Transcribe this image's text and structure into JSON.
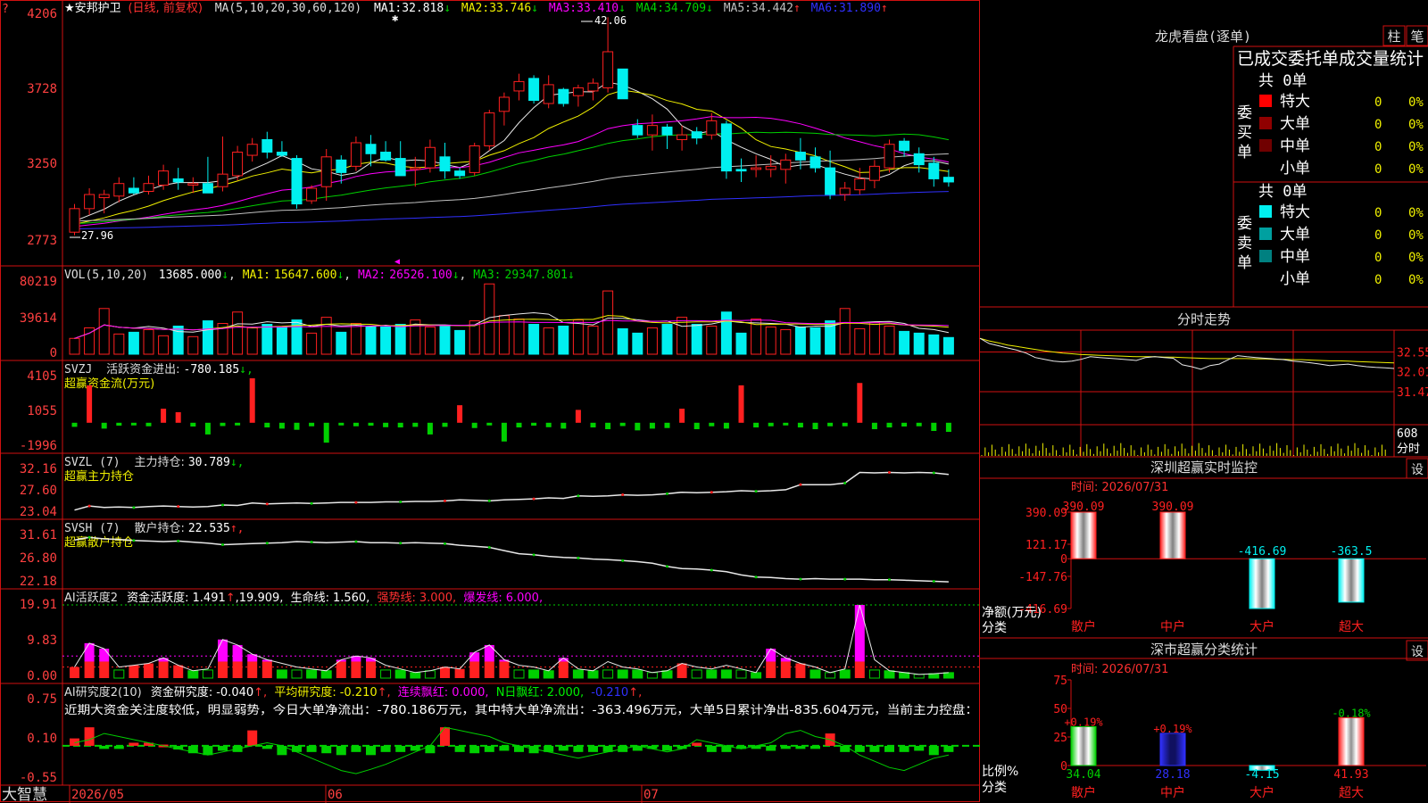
{
  "colors": {
    "up": "#ff2020",
    "down": "#00f0f0",
    "green": "#00d000",
    "frame": "#d01010",
    "axis": "#ff4040",
    "white": "#e8e8e8",
    "yellow": "#f0f000",
    "magenta": "#ff00ff",
    "blue": "#3030ff",
    "gray": "#c0c0c0",
    "text": "#dddddd"
  },
  "header": {
    "title": "★安邦护卫",
    "mode": "(日线, 前复权)",
    "ma_def": "MA(5,10,20,30,60,120)",
    "ma": [
      {
        "label": "MA1:",
        "value": "32.818",
        "arrow": "↓"
      },
      {
        "label": "MA2:",
        "value": "33.746",
        "arrow": "↓"
      },
      {
        "label": "MA3:",
        "value": "33.410",
        "arrow": "↓"
      },
      {
        "label": "MA4:",
        "value": "34.709",
        "arrow": "↓"
      },
      {
        "label": "MA5:",
        "value": "34.442",
        "arrow": "↑"
      },
      {
        "label": "MA6:",
        "value": "31.890",
        "arrow": "↑"
      }
    ],
    "high_label": "42.06",
    "low_label": "27.96",
    "corner": "?"
  },
  "vol_header": {
    "def": "VOL(5,10,20)",
    "value": "13685.000",
    "arrow": "↓",
    "ma": [
      {
        "label": "MA1:",
        "value": "15647.600",
        "arrow": "↓"
      },
      {
        "label": "MA2:",
        "value": "26526.100",
        "arrow": "↓"
      },
      {
        "label": "MA3:",
        "value": "29347.801",
        "arrow": "↓"
      }
    ]
  },
  "svzj_header": {
    "def": "SVZJ",
    "name": "活跃资金进出:",
    "value": "-780.185",
    "arrow": "↓,",
    "sub": "超赢资金流(万元)"
  },
  "svzl_header": {
    "def": "SVZL (7)",
    "name": "主力持仓:",
    "value": "30.789",
    "arrow": "↓,",
    "sub": "超赢主力持仓"
  },
  "svsh_header": {
    "def": "SVSH (7)",
    "name": "散户持仓:",
    "value": "22.535",
    "arrow": "↑,",
    "sub": "超赢散户持仓"
  },
  "ai_header": {
    "def": "AI活跃度2",
    "name": "资金活跃度:",
    "value": "1.491",
    "arrow": "↑",
    "v2": ",19.909,",
    "l3": "生命线:",
    "v3": "1.560,",
    "l4": "强势线:",
    "v4": "3.000,",
    "l5": "爆发线:",
    "v5": "6.000,"
  },
  "yj_header": {
    "def": "AI研究度2(10)",
    "name": "资金研究度:",
    "value": "-0.040",
    "arrow": "↑,",
    "l2": "平均研究度:",
    "v2": "-0.210",
    "a2": "↑,",
    "l3": "连续飘红:",
    "v3": "0.000,",
    "l4": "N日飘红:",
    "v4": "2.000,",
    "v5": "-0.210",
    "a5": "↑,",
    "comment": "近期大资金关注度较低，明显弱势，今日大单净流出：-780.186万元，其中特大单净流出：-363.496万元，大单5日累计净出-835.604万元，当前主力控盘："
  },
  "axes": {
    "price": [
      "4206",
      "3728",
      "3250",
      "2773"
    ],
    "vol": [
      "80219",
      "39614",
      "0"
    ],
    "svzj": [
      "4105",
      "1055",
      "-1996"
    ],
    "svzl": [
      "32.16",
      "27.60",
      "23.04"
    ],
    "svsh": [
      "31.61",
      "26.80",
      "22.18"
    ],
    "ai": [
      "19.91",
      "9.83",
      "0.00"
    ],
    "yj": [
      "0.75",
      "0.10",
      "-0.55"
    ]
  },
  "xaxis": {
    "logo": "大智慧",
    "ticks": [
      "2026/05",
      "06",
      "07"
    ]
  },
  "chart_data": {
    "type": "candlestick",
    "x_count": 60,
    "candles_ohlc": [
      [
        28.4,
        30.2,
        28.2,
        29.9
      ],
      [
        29.9,
        31.2,
        29.5,
        30.8
      ],
      [
        30.6,
        31.1,
        29.6,
        30.8
      ],
      [
        30.7,
        31.9,
        30.3,
        31.5
      ],
      [
        31.2,
        31.9,
        30.8,
        30.9
      ],
      [
        31.0,
        32.0,
        30.8,
        31.5
      ],
      [
        31.4,
        32.7,
        31.1,
        32.3
      ],
      [
        31.8,
        32.5,
        31.1,
        31.6
      ],
      [
        31.4,
        31.9,
        30.9,
        31.5
      ],
      [
        31.5,
        33.2,
        31.3,
        30.9
      ],
      [
        31.3,
        34.5,
        31.0,
        32.1
      ],
      [
        32.0,
        33.9,
        31.7,
        33.5
      ],
      [
        33.3,
        34.4,
        32.9,
        34.0
      ],
      [
        34.3,
        34.8,
        33.1,
        33.5
      ],
      [
        33.5,
        34.2,
        33.2,
        33.3
      ],
      [
        33.1,
        33.3,
        29.9,
        30.2
      ],
      [
        30.4,
        31.4,
        30.2,
        31.2
      ],
      [
        31.3,
        33.7,
        30.4,
        33.2
      ],
      [
        33.0,
        33.3,
        31.5,
        32.2
      ],
      [
        32.6,
        34.5,
        32.3,
        34.1
      ],
      [
        34.0,
        34.6,
        32.6,
        33.4
      ],
      [
        33.5,
        34.2,
        32.9,
        33.0
      ],
      [
        33.1,
        34.2,
        32.9,
        32.0
      ],
      [
        32.4,
        33.2,
        31.3,
        32.5
      ],
      [
        32.5,
        34.3,
        32.2,
        33.8
      ],
      [
        33.2,
        34.1,
        31.8,
        32.3
      ],
      [
        32.3,
        32.5,
        31.8,
        32.0
      ],
      [
        32.2,
        34.1,
        32.0,
        33.9
      ],
      [
        33.9,
        36.2,
        33.6,
        36.0
      ],
      [
        36.1,
        37.3,
        35.2,
        37.0
      ],
      [
        37.4,
        38.5,
        36.8,
        38.0
      ],
      [
        38.2,
        38.4,
        36.6,
        36.8
      ],
      [
        36.6,
        38.4,
        36.3,
        37.8
      ],
      [
        37.5,
        37.6,
        36.4,
        36.6
      ],
      [
        37.1,
        37.8,
        36.4,
        37.6
      ],
      [
        37.4,
        38.2,
        36.8,
        37.9
      ],
      [
        37.6,
        42.1,
        37.3,
        39.9
      ],
      [
        38.8,
        38.8,
        36.9,
        36.9
      ],
      [
        35.2,
        35.6,
        34.4,
        34.6
      ],
      [
        34.6,
        35.9,
        33.6,
        35.2
      ],
      [
        35.1,
        35.3,
        33.7,
        34.6
      ],
      [
        34.3,
        35.2,
        33.6,
        34.6
      ],
      [
        34.8,
        35.1,
        34.0,
        34.4
      ],
      [
        34.6,
        36.0,
        34.3,
        35.5
      ],
      [
        35.3,
        35.5,
        31.8,
        32.3
      ],
      [
        32.4,
        33.1,
        31.6,
        32.3
      ],
      [
        32.4,
        33.3,
        31.9,
        32.5
      ],
      [
        32.4,
        33.3,
        31.9,
        32.6
      ],
      [
        32.4,
        33.4,
        31.5,
        33.0
      ],
      [
        33.5,
        34.4,
        32.4,
        33.0
      ],
      [
        33.2,
        33.8,
        32.2,
        32.5
      ],
      [
        32.5,
        33.6,
        30.5,
        30.8
      ],
      [
        30.8,
        31.6,
        30.4,
        31.2
      ],
      [
        31.1,
        32.5,
        30.8,
        31.8
      ],
      [
        31.7,
        33.0,
        31.2,
        32.6
      ],
      [
        32.5,
        34.3,
        32.2,
        34.0
      ],
      [
        34.2,
        34.4,
        33.2,
        33.6
      ],
      [
        33.4,
        33.8,
        32.2,
        32.7
      ],
      [
        32.8,
        33.2,
        31.3,
        31.8
      ],
      [
        31.9,
        32.4,
        31.3,
        31.6
      ]
    ],
    "volume": [
      18000,
      30000,
      52000,
      23000,
      25000,
      28000,
      21000,
      32000,
      20000,
      38000,
      35000,
      48000,
      30000,
      34000,
      31000,
      39000,
      24000,
      42000,
      25000,
      35000,
      32000,
      31000,
      34000,
      39000,
      31000,
      32000,
      27000,
      38000,
      80000,
      44000,
      40000,
      34000,
      30000,
      32000,
      39000,
      32000,
      72000,
      29000,
      24000,
      30000,
      34000,
      42000,
      34000,
      32000,
      48000,
      24000,
      40000,
      31000,
      28000,
      31000,
      30000,
      38000,
      52000,
      29000,
      36000,
      32000,
      26000,
      24000,
      22000,
      19000
    ],
    "svzj": [
      -350,
      3200,
      -500,
      -250,
      -220,
      -300,
      1200,
      900,
      -320,
      -1000,
      -280,
      -150,
      3800,
      -400,
      -500,
      -600,
      -300,
      -1700,
      -200,
      -300,
      -250,
      -380,
      -400,
      -350,
      -1000,
      -350,
      1500,
      -450,
      -200,
      -1600,
      -400,
      -250,
      -380,
      -500,
      1100,
      -400,
      -550,
      -280,
      -650,
      -500,
      -450,
      1200,
      -550,
      -300,
      -500,
      3200,
      -400,
      -300,
      -200,
      -400,
      -550,
      -300,
      -300,
      3400,
      -550,
      -400,
      -320,
      -300,
      -700,
      -780
    ],
    "svzl": [
      23.8,
      24.6,
      24.3,
      24.4,
      24.3,
      24.5,
      24.6,
      24.5,
      24.4,
      24.5,
      24.8,
      24.7,
      25.2,
      25.0,
      25.1,
      25.2,
      25.1,
      25.2,
      25.3,
      25.3,
      25.3,
      25.4,
      25.4,
      25.5,
      25.5,
      25.6,
      25.8,
      25.7,
      25.6,
      25.8,
      25.9,
      26.0,
      26.2,
      26.1,
      26.6,
      26.5,
      26.6,
      26.8,
      26.7,
      26.8,
      27.0,
      27.3,
      27.2,
      27.3,
      27.4,
      27.6,
      27.5,
      27.6,
      27.8,
      28.8,
      28.8,
      28.8,
      29.1,
      31.2,
      31.1,
      31.2,
      31.1,
      31.2,
      31.1,
      30.8
    ],
    "svsh": [
      30.4,
      30.9,
      30.6,
      30.5,
      30.3,
      30.2,
      30.1,
      30.2,
      30.0,
      29.8,
      29.5,
      29.6,
      29.7,
      29.8,
      29.9,
      30.1,
      30.0,
      29.9,
      30.0,
      30.1,
      29.9,
      29.9,
      29.8,
      29.9,
      29.8,
      29.7,
      29.4,
      29.2,
      29.0,
      28.4,
      27.8,
      27.6,
      27.3,
      27.1,
      27.0,
      26.8,
      26.7,
      26.5,
      26.3,
      26.0,
      25.4,
      25.0,
      24.9,
      24.7,
      24.4,
      23.8,
      23.4,
      23.3,
      23.1,
      23.0,
      23.1,
      23.0,
      23.0,
      23.0,
      22.9,
      22.9,
      22.8,
      22.7,
      22.6,
      22.5
    ],
    "ai_activity": [
      3.0,
      9.5,
      8.0,
      3.0,
      3.5,
      4.0,
      5.5,
      3.5,
      2.0,
      2.5,
      10.5,
      9.0,
      6.5,
      5.0,
      4.0,
      3.0,
      2.5,
      2.0,
      5.0,
      6.0,
      5.5,
      3.5,
      2.5,
      1.5,
      2.0,
      3.0,
      2.5,
      7.0,
      9.0,
      5.0,
      3.5,
      3.0,
      2.0,
      5.5,
      2.5,
      2.0,
      4.5,
      3.0,
      2.5,
      1.5,
      2.0,
      4.0,
      3.0,
      2.5,
      3.5,
      2.5,
      1.5,
      8.0,
      5.5,
      4.0,
      3.0,
      1.5,
      2.5,
      19.91,
      5.0,
      2.0,
      1.5,
      1.0,
      1.2,
      1.49
    ],
    "ai_red": [
      true,
      true,
      true,
      false,
      true,
      true,
      true,
      true,
      false,
      false,
      true,
      true,
      true,
      true,
      false,
      false,
      false,
      false,
      true,
      true,
      true,
      false,
      false,
      false,
      false,
      true,
      true,
      true,
      true,
      true,
      false,
      false,
      false,
      true,
      false,
      false,
      false,
      false,
      false,
      false,
      false,
      true,
      false,
      false,
      false,
      false,
      false,
      true,
      true,
      true,
      false,
      false,
      false,
      true,
      false,
      false,
      false,
      false,
      false,
      false
    ],
    "ai_lines": {
      "strong": 3.0,
      "burst": 6.0,
      "max": 19.91
    },
    "yj_bars": [
      0.12,
      0.3,
      -0.05,
      -0.05,
      0.05,
      0.05,
      0.02,
      -0.06,
      -0.12,
      -0.15,
      -0.08,
      -0.1,
      0.25,
      -0.05,
      -0.15,
      -0.1,
      -0.1,
      -0.12,
      -0.15,
      -0.1,
      -0.15,
      -0.1,
      -0.1,
      -0.08,
      -0.12,
      0.3,
      -0.1,
      -0.12,
      -0.1,
      -0.08,
      -0.1,
      -0.12,
      -0.1,
      -0.08,
      -0.1,
      -0.1,
      -0.1,
      -0.1,
      -0.08,
      -0.05,
      -0.08,
      -0.05,
      0.05,
      -0.1,
      -0.1,
      -0.05,
      -0.05,
      -0.08,
      -0.05,
      -0.05,
      -0.05,
      0.2,
      -0.1,
      -0.1,
      -0.1,
      -0.1,
      -0.1,
      -0.08,
      -0.15,
      -0.1
    ]
  },
  "longhu": {
    "title": "龙虎看盘(逐单)",
    "btn1": "柱",
    "btn2": "笔",
    "tabs": "已成交委托单成交量统计",
    "buy": {
      "side": "委买单",
      "total": "共 0单",
      "rows": [
        {
          "name": "特大",
          "v": "0",
          "p": "0%",
          "color": "#ff0000"
        },
        {
          "name": "大单",
          "v": "0",
          "p": "0%",
          "color": "#900000"
        },
        {
          "name": "中单",
          "v": "0",
          "p": "0%",
          "color": "#700000"
        },
        {
          "name": "小单",
          "v": "0",
          "p": "0%",
          "color": ""
        }
      ]
    },
    "sell": {
      "side": "委卖单",
      "total": "共 0单",
      "rows": [
        {
          "name": "特大",
          "v": "0",
          "p": "0%",
          "color": "#00f0f0"
        },
        {
          "name": "大单",
          "v": "0",
          "p": "0%",
          "color": "#00a0a0"
        },
        {
          "name": "中单",
          "v": "0",
          "p": "0%",
          "color": "#008080"
        },
        {
          "name": "小单",
          "v": "0",
          "p": "0%",
          "color": ""
        }
      ]
    }
  },
  "intraday": {
    "title": "分时走势",
    "yticks": [
      "32.55",
      "32.01",
      "31.47"
    ],
    "vol_tick": "608",
    "vol_label": "分时",
    "price": [
      32.92,
      32.78,
      32.72,
      32.66,
      32.6,
      32.52,
      32.4,
      32.35,
      32.3,
      32.28,
      32.3,
      32.35,
      32.42,
      32.4,
      32.38,
      32.36,
      32.34,
      32.32,
      32.4,
      32.42,
      32.4,
      32.38,
      32.2,
      32.15,
      32.08,
      32.18,
      32.22,
      32.34,
      32.45,
      32.42,
      32.4,
      32.38,
      32.36,
      32.34,
      32.3,
      32.28,
      32.25,
      32.22,
      32.18,
      32.2,
      32.22,
      32.18,
      32.15,
      32.13,
      32.12,
      32.1
    ],
    "avg": [
      32.92,
      32.85,
      32.8,
      32.74,
      32.7,
      32.66,
      32.62,
      32.58,
      32.55,
      32.52,
      32.5,
      32.48,
      32.47,
      32.46,
      32.45,
      32.44,
      32.43,
      32.42,
      32.42,
      32.42,
      32.41,
      32.41,
      32.4,
      32.39,
      32.38,
      32.37,
      32.37,
      32.37,
      32.37,
      32.37,
      32.36,
      32.36,
      32.35,
      32.35,
      32.34,
      32.34,
      32.33,
      32.32,
      32.31,
      32.31,
      32.3,
      32.29,
      32.28,
      32.27,
      32.26,
      32.25
    ]
  },
  "szmon": {
    "title": "深圳超赢实时监控",
    "btn": "设",
    "time": "时间: 2026/07/31",
    "yticks": [
      "390.09",
      "121.17",
      "0",
      "-147.76",
      "-416.69"
    ],
    "ylabel": "净额(万元)",
    "xlabel": "分类",
    "cats": [
      "散户",
      "中户",
      "大户",
      "超大"
    ],
    "values": [
      390.09,
      390.09,
      -416.69,
      -363.5
    ],
    "labels": [
      "390.09",
      "390.09",
      "-416.69",
      "-363.5"
    ]
  },
  "szcls": {
    "title": "深市超赢分类统计",
    "btn": "设",
    "time": "时间: 2026/07/31",
    "yticks": [
      "75",
      "50",
      "25",
      "0"
    ],
    "ylabel": "比例%",
    "xlabel": "分类",
    "cats": [
      "散户",
      "中户",
      "大户",
      "超大"
    ],
    "values": [
      34.04,
      28.18,
      -4.15,
      41.93
    ],
    "labels": [
      "34.04",
      "28.18",
      "-4.15",
      "41.93"
    ],
    "chg": [
      "+0.19%",
      "+0.19%",
      "",
      "-0.18%"
    ]
  }
}
